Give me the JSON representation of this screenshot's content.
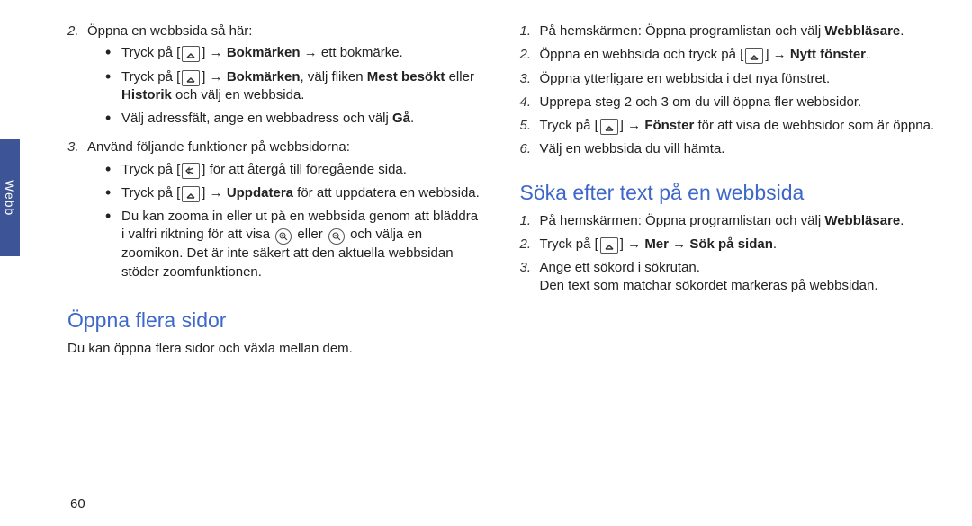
{
  "side_tab": "Webb",
  "page_number": "60",
  "left": {
    "step2_lead": "Öppna en webbsida så här:",
    "b1_a": "Tryck på [",
    "b1_b": "] → ",
    "b1_bold": "Bokmärken",
    "b1_c": " → ett bokmärke.",
    "b2_a": "Tryck på [",
    "b2_b": "] → ",
    "b2_bold1": "Bokmärken",
    "b2_c": ", välj fliken ",
    "b2_bold2": "Mest besökt",
    "b2_d": " eller ",
    "b2_bold3": "Historik",
    "b2_e": " och välj en webbsida.",
    "b3_a": "Välj adressfält, ange en webbadress och välj ",
    "b3_bold": "Gå",
    "b3_dot": ".",
    "step3_lead": "Använd följande funktioner på webbsidorna:",
    "s3b1_a": "Tryck på [",
    "s3b1_b": "] för att återgå till föregående sida.",
    "s3b2_a": "Tryck på [",
    "s3b2_b": "] → ",
    "s3b2_bold": "Uppdatera",
    "s3b2_c": " för att uppdatera en webbsida.",
    "s3b3_a": "Du kan zooma in eller ut på en webbsida genom att bläddra i valfri riktning för att visa ",
    "s3b3_b": " eller ",
    "s3b3_c": " och välja en zoomikon. Det är inte säkert att den aktuella webbsidan stöder zoomfunktionen.",
    "heading": "Öppna flera sidor",
    "intro": "Du kan öppna flera sidor och växla mellan dem."
  },
  "right": {
    "r1_a": "På hemskärmen: Öppna programlistan och välj ",
    "r1_bold": "Webbläsare",
    "r1_dot": ".",
    "r2_a": "Öppna en webbsida och tryck på [",
    "r2_b": "] → ",
    "r2_bold": "Nytt fönster",
    "r2_dot": ".",
    "r3": "Öppna ytterligare en webbsida i det nya fönstret.",
    "r4": "Upprepa steg 2 och 3 om du vill öppna fler webbsidor.",
    "r5_a": "Tryck på [",
    "r5_b": "] → ",
    "r5_bold": "Fönster",
    "r5_c": " för att visa de webbsidor som är öppna.",
    "r6": "Välj en webbsida du vill hämta.",
    "heading": "Söka efter text på en webbsida",
    "s1_a": "På hemskärmen: Öppna programlistan och välj ",
    "s1_bold": "Webbläsare",
    "s1_dot": ".",
    "s2_a": "Tryck på [",
    "s2_b": "] → ",
    "s2_bold1": "Mer",
    "s2_c": " → ",
    "s2_bold2": "Sök på sidan",
    "s2_dot": ".",
    "s3_a": "Ange ett sökord i sökrutan.",
    "s3_b": "Den text som matchar sökordet markeras på webbsidan."
  },
  "nums": {
    "n1": "1",
    "n2": "2",
    "n3": "3",
    "n4": "4",
    "n5": "5",
    "n6": "6"
  },
  "arrow": "→"
}
